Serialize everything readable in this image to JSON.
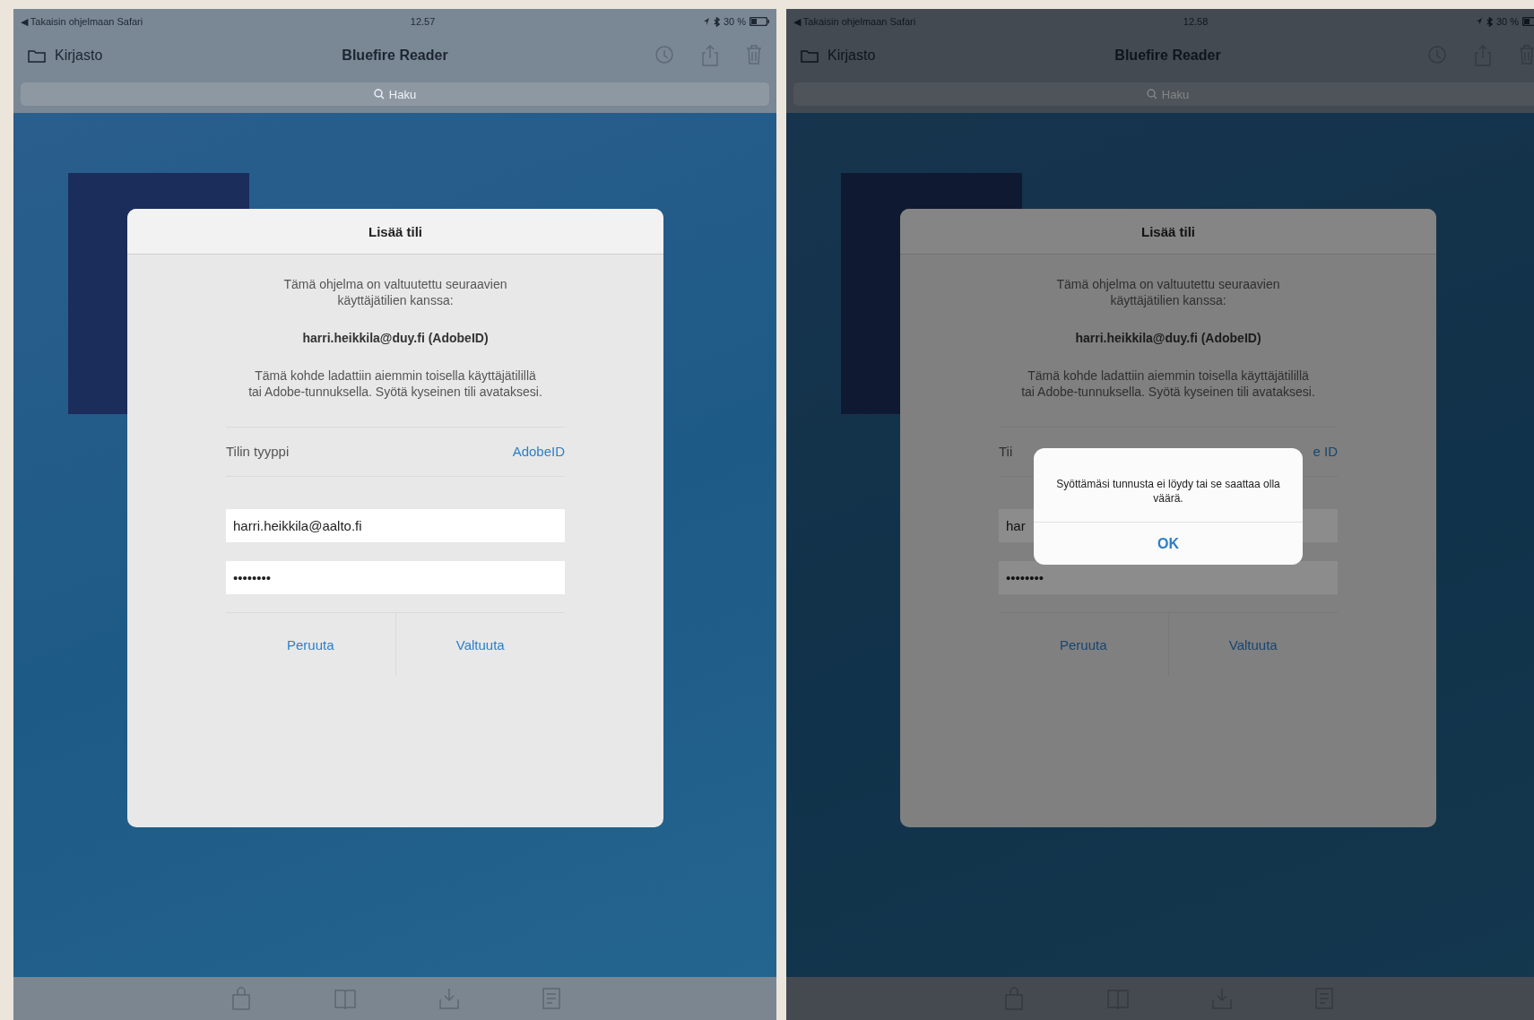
{
  "screens": [
    {
      "status_bar": {
        "back": "◀ Takaisin ohjelmaan Safari",
        "time": "12.57",
        "battery": "30 %"
      },
      "nav_bar": {
        "back": "Kirjasto",
        "title": "Bluefire Reader"
      },
      "search": {
        "placeholder": "Haku"
      },
      "dialog": {
        "title": "Lisää tili",
        "intro": "Tämä ohjelma on valtuutettu seuraavien käyttäjätilien kanssa:",
        "account": "harri.heikkila@duy.fi (AdobeID)",
        "message": "Tämä kohde ladattiin aiemmin toisella käyttäjätilillä tai Adobe-tunnuksella. Syötä kyseinen tili avataksesi.",
        "account_type_label": "Tilin tyyppi",
        "account_type_value": "AdobeID",
        "email": "harri.heikkila@aalto.fi",
        "password": "••••••••",
        "buttons": [
          "Peruuta",
          "Valtuuta"
        ]
      }
    },
    {
      "status_bar": {
        "back": "◀ Takaisin ohjelmaan Safari",
        "time": "12.58",
        "battery": "30 %"
      },
      "nav_bar": {
        "back": "Kirjasto",
        "title": "Bluefire Reader"
      },
      "search": {
        "placeholder": "Haku"
      },
      "dialog": {
        "title": "Lisää tili",
        "intro": "Tämä ohjelma on valtuutettu seuraavien käyttäjätilien kanssa:",
        "account": "harri.heikkila@duy.fi (AdobeID)",
        "message": "Tämä kohde ladattiin aiemmin toisella käyttäjätilillä tai Adobe-tunnuksella. Syötä kyseinen tili avataksesi.",
        "account_type_label": "Tii",
        "account_type_value": "e ID",
        "email": "har",
        "password": "••••••••",
        "buttons": [
          "Peruuta",
          "Valtuuta"
        ]
      },
      "alert": {
        "message": "Syöttämäsi tunnusta ei löydy tai se saattaa olla väärä.",
        "button": "OK"
      }
    }
  ]
}
